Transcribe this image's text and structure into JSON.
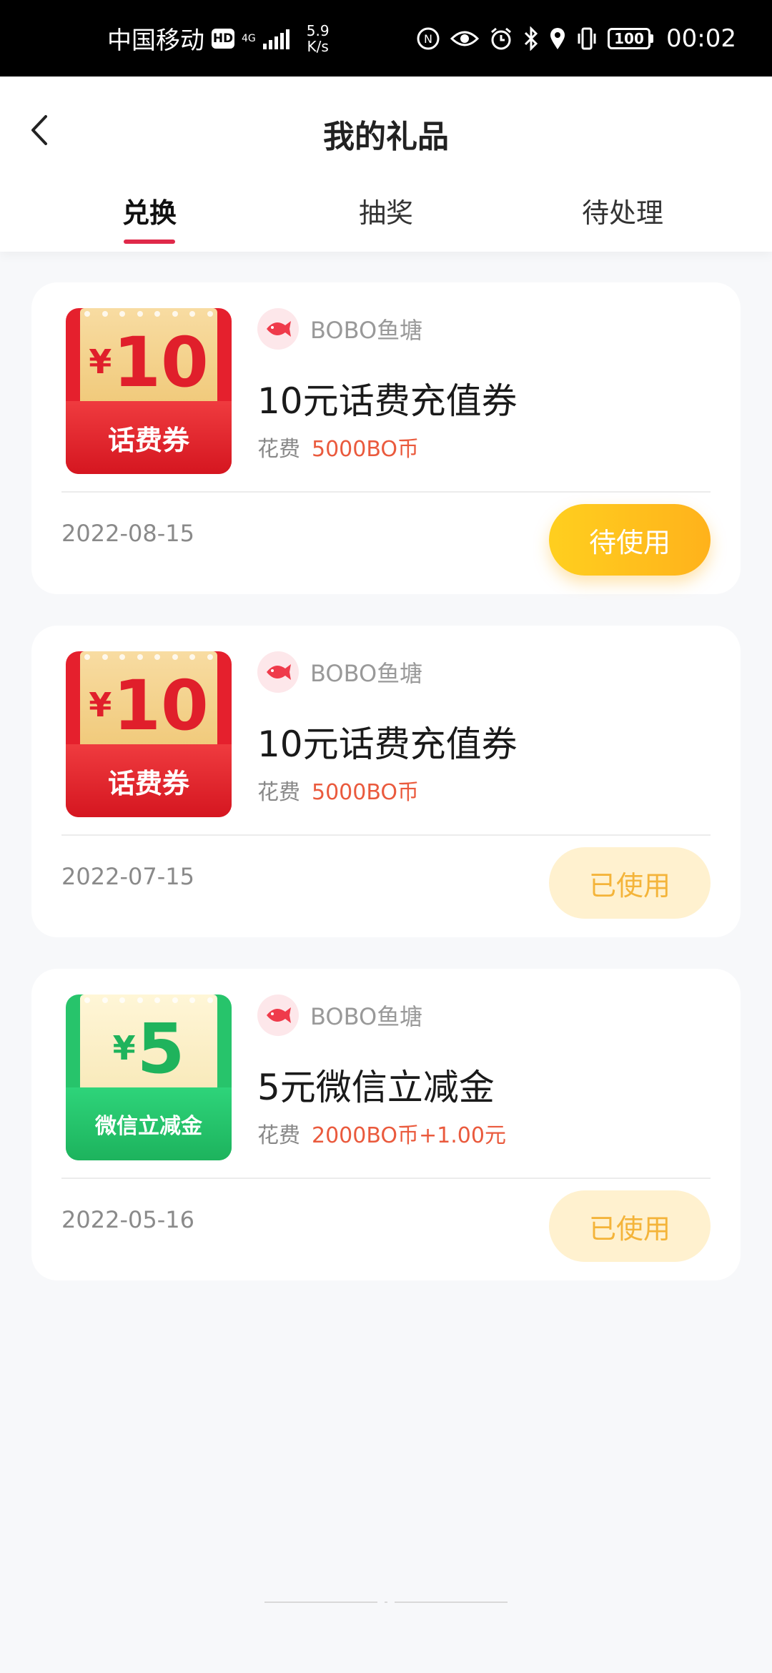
{
  "status_bar": {
    "carrier": "中国移动",
    "hd": "HD",
    "network": "4G",
    "speed_value": "5.9",
    "speed_unit": "K/s",
    "battery": "100",
    "time": "00:02"
  },
  "header": {
    "title": "我的礼品",
    "tabs": [
      {
        "label": "兑换"
      },
      {
        "label": "抽奖"
      },
      {
        "label": "待处理"
      }
    ]
  },
  "colors": {
    "accent": "#e0294a",
    "price": "#ea5a3d",
    "pending": "#ffbf1e",
    "used_bg": "#fff1cf"
  },
  "cards": [
    {
      "thumb_symbol": "¥",
      "thumb_amount": "10",
      "thumb_label": "话费券",
      "shop": "BOBO鱼塘",
      "title": "10元话费充值券",
      "cost_label": "花费",
      "cost": "5000BO币",
      "date": "2022-08-15",
      "status": "待使用"
    },
    {
      "thumb_symbol": "¥",
      "thumb_amount": "10",
      "thumb_label": "话费券",
      "shop": "BOBO鱼塘",
      "title": "10元话费充值券",
      "cost_label": "花费",
      "cost": "5000BO币",
      "date": "2022-07-15",
      "status": "已使用"
    },
    {
      "thumb_symbol": "¥",
      "thumb_amount": "5",
      "thumb_label": "微信立减金",
      "shop": "BOBO鱼塘",
      "title": "5元微信立减金",
      "cost_label": "花费",
      "cost": "2000BO币+1.00元",
      "date": "2022-05-16",
      "status": "已使用"
    }
  ]
}
